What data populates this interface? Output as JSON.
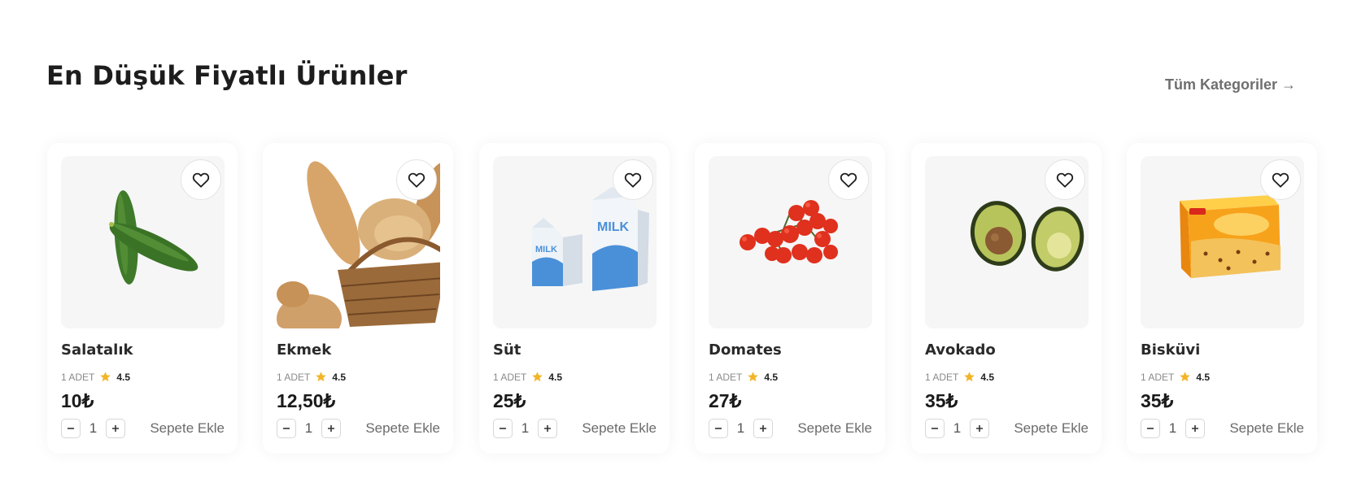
{
  "section": {
    "title": "En Düşük Fiyatlı Ürünler",
    "all_categories_link": "Tüm Kategoriler →"
  },
  "products": [
    {
      "name": "Salatalık",
      "unit": "1 ADET",
      "rating": "4.5",
      "price": "10₺",
      "qty": "1",
      "add_label": "Sepete Ekle",
      "image_icon": "cucumber"
    },
    {
      "name": "Ekmek",
      "unit": "1 ADET",
      "rating": "4.5",
      "price": "12,50₺",
      "qty": "1",
      "add_label": "Sepete Ekle",
      "image_icon": "bread-basket"
    },
    {
      "name": "Süt",
      "unit": "1 ADET",
      "rating": "4.5",
      "price": "25₺",
      "qty": "1",
      "add_label": "Sepete Ekle",
      "image_icon": "milk-cartons",
      "image_text": [
        "MILK",
        "MILK"
      ]
    },
    {
      "name": "Domates",
      "unit": "1 ADET",
      "rating": "4.5",
      "price": "27₺",
      "qty": "1",
      "add_label": "Sepete Ekle",
      "image_icon": "cherry-tomatoes"
    },
    {
      "name": "Avokado",
      "unit": "1 ADET",
      "rating": "4.5",
      "price": "35₺",
      "qty": "1",
      "add_label": "Sepete Ekle",
      "image_icon": "avocado-halves"
    },
    {
      "name": "Bisküvi",
      "unit": "1 ADET",
      "rating": "4.5",
      "price": "35₺",
      "qty": "1",
      "add_label": "Sepete Ekle",
      "image_icon": "cookie-box"
    }
  ],
  "colors": {
    "star": "#f2b52a",
    "card_image_bg": "#f6f6f6",
    "text_dark": "#1d1d1d",
    "text_muted": "#6f6f6f"
  }
}
